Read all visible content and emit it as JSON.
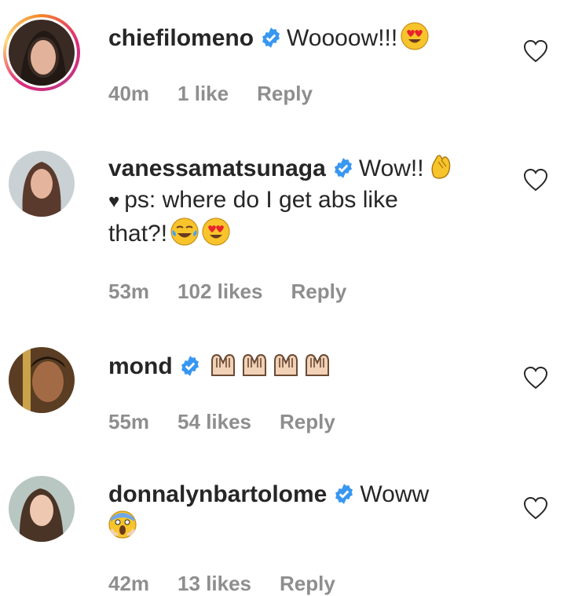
{
  "comments": [
    {
      "username": "chiefilomeno",
      "text": "Woooow!!!",
      "time": "40m",
      "likes": "1 like",
      "reply": "Reply"
    },
    {
      "username": "vanessamatsunaga",
      "text_line1": "Wow!!",
      "text_line2": "ps: where do I get abs like",
      "text_line3": "that?!",
      "time": "53m",
      "likes": "102 likes",
      "reply": "Reply"
    },
    {
      "username": "mond",
      "time": "55m",
      "likes": "54 likes",
      "reply": "Reply"
    },
    {
      "username": "donnalynbartolome",
      "text": "Woww",
      "time": "42m",
      "likes": "13 likes",
      "reply": "Reply"
    }
  ],
  "colors": {
    "verified": "#3897f0",
    "meta": "#8e8e8e",
    "text": "#262626"
  }
}
